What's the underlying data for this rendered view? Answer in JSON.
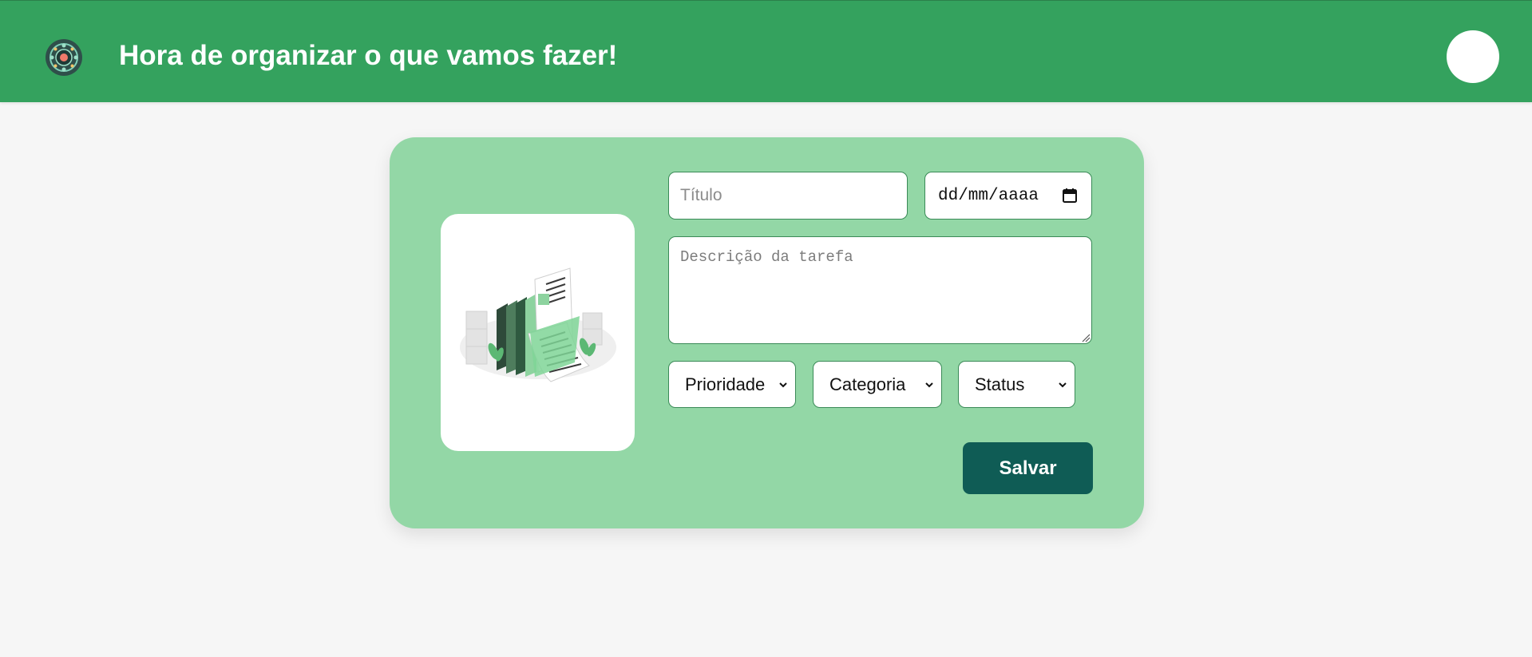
{
  "header": {
    "title": "Hora de organizar o que vamos fazer!",
    "logo_icon": "mandala-logo-icon",
    "avatar_icon": "avatar-icon"
  },
  "form": {
    "title_placeholder": "Título",
    "date_placeholder": "dd/mm/aaaa",
    "date_icon": "calendar-icon",
    "description_placeholder": "Descrição da tarefa",
    "priority_label": "Prioridade",
    "category_label": "Categoria",
    "status_label": "Status",
    "save_label": "Salvar",
    "illustration_icon": "documents-illustration"
  },
  "colors": {
    "header_bg": "#34a25e",
    "card_bg": "#93d7a6",
    "save_button_bg": "#0f5c55",
    "page_bg": "#f6f6f6"
  }
}
